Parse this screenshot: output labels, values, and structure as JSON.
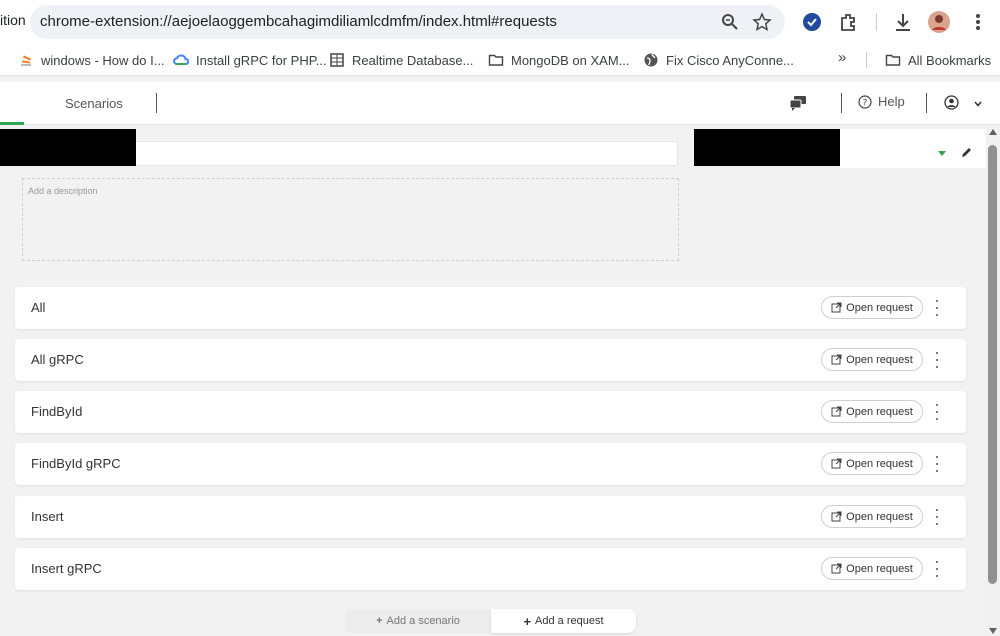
{
  "browser": {
    "tab_fragment": "ition",
    "url": "chrome-extension://aejoelaoggembcahagimdiliamlcdmfm/index.html#requests",
    "bookmarks": [
      {
        "label": "windows - How do I...",
        "icon": "stackoverflow-icon"
      },
      {
        "label": "Install gRPC for PHP...",
        "icon": "gcloud-icon"
      },
      {
        "label": "Realtime Database...",
        "icon": "database-icon"
      },
      {
        "label": "MongoDB on XAM...",
        "icon": "folder-icon"
      },
      {
        "label": "Fix Cisco AnyConne...",
        "icon": "globe-icon"
      }
    ],
    "overflow_label": "»",
    "all_bookmarks_label": "All Bookmarks"
  },
  "header": {
    "scenarios_label": "Scenarios",
    "help_label": "Help"
  },
  "scenario": {
    "name_value": "",
    "description_placeholder": "Add a description"
  },
  "requests": [
    {
      "name": "All"
    },
    {
      "name": "All gRPC"
    },
    {
      "name": "FindById"
    },
    {
      "name": "FindById gRPC"
    },
    {
      "name": "Insert"
    },
    {
      "name": "Insert gRPC"
    }
  ],
  "labels": {
    "open_request": "Open request",
    "add_scenario": "Add a scenario",
    "add_request": "Add a request"
  },
  "colors": {
    "accent": "#2ea44f",
    "background": "#f2f2f2",
    "url_bar": "#eef1f6"
  }
}
